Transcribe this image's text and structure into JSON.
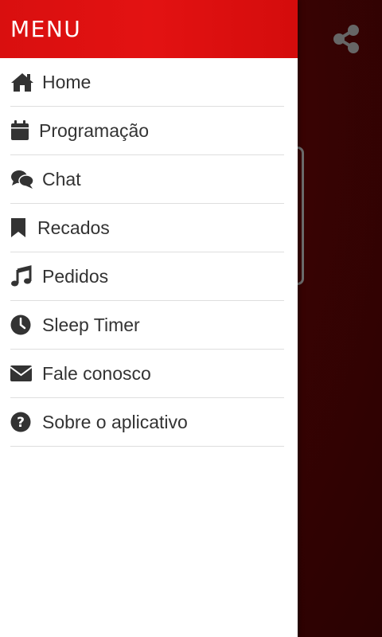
{
  "header": {
    "title": "MENU"
  },
  "share": {
    "icon": "share-icon"
  },
  "colors": {
    "header_red": "#e31212",
    "background_dark_red": "#3a0303",
    "icon_color": "#333333",
    "share_icon_color": "#666666"
  },
  "menu": {
    "items": [
      {
        "label": "Home",
        "icon": "home-icon"
      },
      {
        "label": "Programação",
        "icon": "calendar-icon"
      },
      {
        "label": "Chat",
        "icon": "chat-icon"
      },
      {
        "label": "Recados",
        "icon": "bookmark-icon"
      },
      {
        "label": "Pedidos",
        "icon": "music-icon"
      },
      {
        "label": "Sleep Timer",
        "icon": "clock-icon"
      },
      {
        "label": "Fale conosco",
        "icon": "envelope-icon"
      },
      {
        "label": "Sobre o aplicativo",
        "icon": "question-icon"
      }
    ]
  }
}
